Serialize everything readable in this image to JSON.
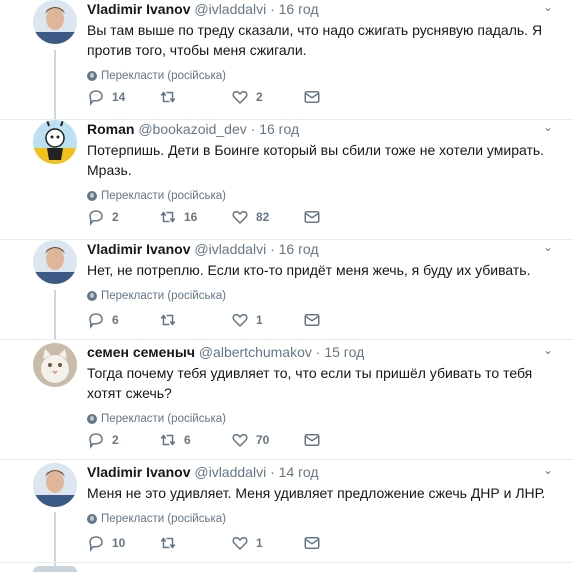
{
  "colors": {
    "text": "#14171a",
    "muted": "#657786",
    "thread_line": "#ccd6dd",
    "divider": "#e6ecf0"
  },
  "menu_icon": "chevron-down-icon",
  "tweets": [
    {
      "name": "Vladimir Ivanov",
      "handle": "@ivladdalvi",
      "dot": "·",
      "time": "16 год",
      "text": "Вы там выше по треду сказали, что надо сжигать руснявую падаль. Я против того, чтобы меня сжигали.",
      "translate": "Перекласти (російська)",
      "replies": "14",
      "retweets": "",
      "likes": "2"
    },
    {
      "name": "Roman",
      "handle": "@bookazoid_dev",
      "dot": "·",
      "time": "16 год",
      "text": "Потерпишь. Дети в Боинге который вы сбили тоже не хотели умирать. Мразь.",
      "translate": "Перекласти (російська)",
      "replies": "2",
      "retweets": "16",
      "likes": "82"
    },
    {
      "name": "Vladimir Ivanov",
      "handle": "@ivladdalvi",
      "dot": "·",
      "time": "16 год",
      "text": "Нет, не потреплю. Если кто-то придёт меня жечь, я буду их убивать.",
      "translate": "Перекласти (російська)",
      "replies": "6",
      "retweets": "",
      "likes": "1"
    },
    {
      "name": "семен семеныч",
      "handle": "@albertchumakov",
      "dot": "·",
      "time": "15 год",
      "text": "Тогда почему тебя удивляет то, что если ты пришёл убивать то тебя хотят сжечь?",
      "translate": "Перекласти (російська)",
      "replies": "2",
      "retweets": "6",
      "likes": "70"
    },
    {
      "name": "Vladimir Ivanov",
      "handle": "@ivladdalvi",
      "dot": "·",
      "time": "14 год",
      "text": "Меня не это удивляет. Меня удивляет предложение сжечь ДНР и ЛНР.",
      "translate": "Перекласти (російська)",
      "replies": "10",
      "retweets": "",
      "likes": "1"
    }
  ]
}
